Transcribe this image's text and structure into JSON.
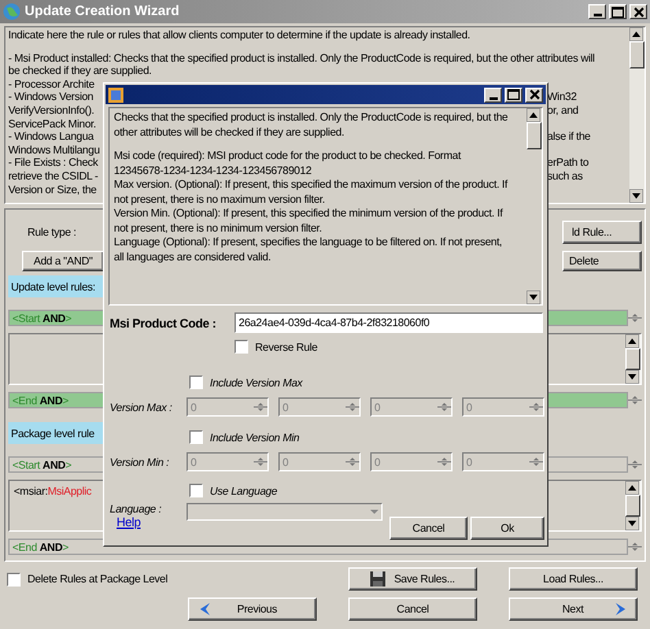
{
  "window": {
    "title": "Update Creation Wizard"
  },
  "description": {
    "paragraphs": [
      {
        "lines": [
          {
            "left": "Indicate here the rule or rules that allow clients computer to determine if the update is already installed."
          }
        ]
      },
      {
        "lines": [
          {
            "left": " - Msi Product installed: Checks that the specified product is installed. Only the ProductCode is required, but the other attributes will"
          },
          {
            "left": "be checked if they are supplied."
          },
          {
            "left": " - Processor Archite"
          },
          {
            "left": " - Windows Version",
            "right": "Win32"
          },
          {
            "left": "VerifyVersionInfo().",
            "right": "or, and"
          },
          {
            "left": "ServicePack Minor."
          },
          {
            "left": " - Windows Langua",
            "right": "alse if the"
          },
          {
            "left": "Windows Multilangu"
          },
          {
            "left": " - File Exists : Check",
            "right": "erPath to"
          },
          {
            "left": "retrieve the CSIDL -",
            "right": "such as"
          },
          {
            "left": "Version or Size, the"
          }
        ]
      }
    ]
  },
  "rule_type_label": "Rule type :",
  "add_and_button": "Add a \"AND\"",
  "add_rule_button": "ld Rule...",
  "delete_button": "Delete",
  "update_rules": {
    "label": "Update level rules:",
    "start": {
      "text": "<Start **AND**>",
      "selected": true
    },
    "end": {
      "text": "<End **AND**>",
      "selected": true
    }
  },
  "package_rules": {
    "label": "Package level rule",
    "start": {
      "text": "<Start **AND**>",
      "selected": false
    },
    "rules": [
      {
        "prefix": "<msiar:",
        "name": "MsiApplic"
      }
    ],
    "end": {
      "text": "<End **AND**>",
      "selected": false
    }
  },
  "delete_rules_checkbox": {
    "label": "Delete Rules at Package Level",
    "checked": false
  },
  "buttons": {
    "save": "Save Rules...",
    "load": "Load Rules...",
    "previous": "Previous",
    "cancel": "Cancel",
    "next": "Next"
  },
  "dialog": {
    "description": {
      "paragraphs": [
        {
          "lines": [
            "Checks that the specified product is installed. Only the ProductCode is required, but the",
            "other attributes will be checked if they are supplied."
          ]
        },
        {
          "lines": [
            "Msi code (required): MSI product code for the product to be checked. Format",
            "12345678-1234-1234-1234-123456789012",
            "Max version. (Optional): If present, this specified the maximum version of the product. If",
            "not present, there is no maximum version filter.",
            "Version Min. (Optional): If present, this specified the minimum version of the product. If",
            "not present, there is no minimum version filter.",
            "Language (Optional): If present, specifies the language to be filtered on. If not present,",
            "all languages are considered valid."
          ]
        }
      ]
    },
    "code": {
      "label": "Msi Product Code :",
      "value": "26a24ae4-039d-4ca4-87b4-2f83218060f0"
    },
    "reverse_rule": {
      "label": "Reverse Rule",
      "checked": false
    },
    "version_max": {
      "include_label": "Include Version Max",
      "checked": false,
      "label": "Version Max :",
      "disabled": true,
      "values": [
        "0",
        "0",
        "0",
        "0"
      ]
    },
    "version_min": {
      "include_label": "Include Version Min",
      "checked": false,
      "label": "Version Min :",
      "disabled": true,
      "values": [
        "0",
        "0",
        "0",
        "0"
      ]
    },
    "language": {
      "include_label": "Use Language",
      "checked": false,
      "label": "Language :",
      "disabled": true
    },
    "help": "Help",
    "buttons": {
      "cancel": "Cancel",
      "ok": "Ok"
    }
  }
}
